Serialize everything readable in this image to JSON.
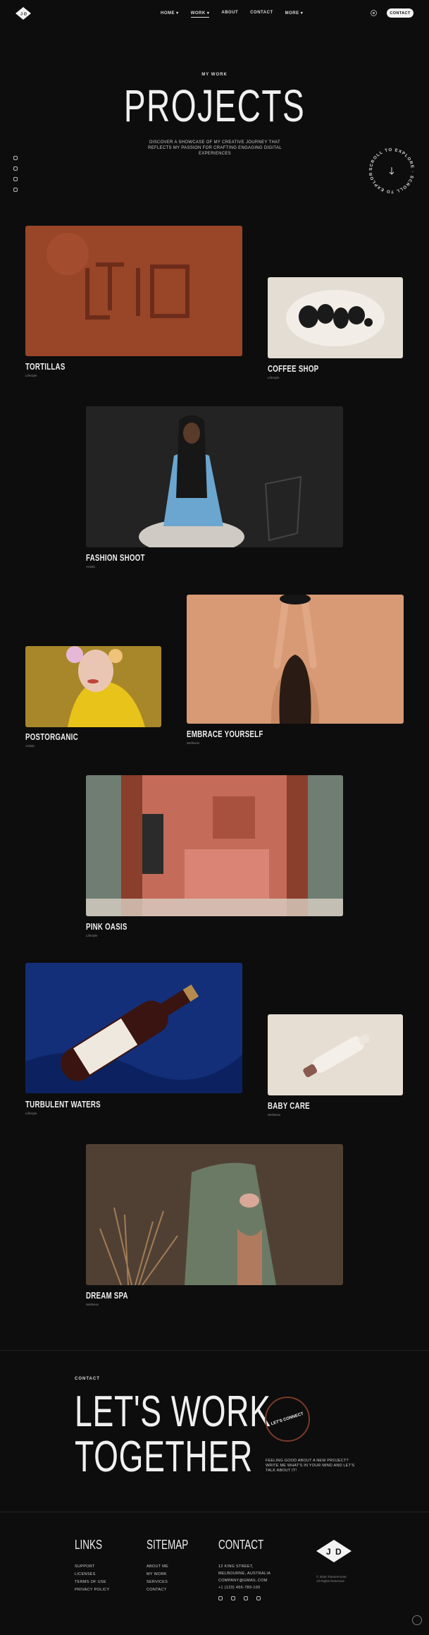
{
  "header": {
    "logo_text": "J D",
    "nav": [
      {
        "label": "HOME",
        "has_dropdown": true
      },
      {
        "label": "WORK",
        "has_dropdown": true,
        "active": true
      },
      {
        "label": "ABOUT",
        "has_dropdown": false
      },
      {
        "label": "CONTACT",
        "has_dropdown": false
      },
      {
        "label": "MORE",
        "has_dropdown": true
      }
    ],
    "nav_text": {
      "home": "HOME ▾",
      "work": "WORK ▾",
      "about": "ABOUT",
      "contact": "CONTACT",
      "more": "MORE ▾"
    },
    "cta_label": "CONTACT"
  },
  "hero": {
    "kicker": "MY WORK",
    "title": "PROJECTS",
    "subtitle": "DISCOVER A SHOWCASE OF MY CREATIVE JOURNEY THAT REFLECTS MY PASSION FOR CRAFTING ENGAGING DIGITAL EXPERIENCES",
    "scroll_badge": "SCROLL TO EXPLORE · SCROLL TO EXPLORE ·"
  },
  "social_icons": [
    "facebook-icon",
    "instagram-icon",
    "behance-icon",
    "youtube-icon"
  ],
  "projects": [
    {
      "title": "TORTILLAS",
      "category": "Lifestyle"
    },
    {
      "title": "COFFEE SHOP",
      "category": "Lifestyle"
    },
    {
      "title": "FASHION SHOOT",
      "category": "Artistic"
    },
    {
      "title": "POSTORGANIC",
      "category": "Artistic"
    },
    {
      "title": "EMBRACE YOURSELF",
      "category": "Wellness"
    },
    {
      "title": "PINK OASIS",
      "category": "Lifestyle"
    },
    {
      "title": "TURBULENT WATERS",
      "category": "Lifestyle"
    },
    {
      "title": "BABY CARE",
      "category": "Wellness"
    },
    {
      "title": "DREAM SPA",
      "category": "Wellness"
    }
  ],
  "contact": {
    "kicker": "CONTACT",
    "headline_line1": "LET'S WORK",
    "headline_line2": "TOGETHER",
    "circle_label": "LET'S CONNECT",
    "text": "FEELING GOOD ABOUT A NEW PROJECT? WRITE ME WHAT'S IN YOUR MIND AND LET'S TALK ABOUT IT!"
  },
  "footer": {
    "links": {
      "title": "LINKS",
      "items": [
        "SUPPORT",
        "LICENSES",
        "TERMS OF USE",
        "PRIVACY POLICY"
      ]
    },
    "sitemap": {
      "title": "SITEMAP",
      "items": [
        "ABOUT ME",
        "MY WORK",
        "SERVICES",
        "CONTACT"
      ]
    },
    "contact": {
      "title": "CONTACT",
      "items": [
        "12 KING STREET,",
        "MELBOURNE, AUSTRALIA",
        "COMPANY@GMAIL.COM",
        "+1 (123) 456-789-100"
      ]
    },
    "logo_text": "J D",
    "copyright_1": "© 2025 ThemeForest",
    "copyright_2": "All Rights Reserved"
  },
  "colors": {
    "background": "#0d0d0d",
    "text": "#e8e8e8",
    "accent_circle": "#7a3a28"
  }
}
